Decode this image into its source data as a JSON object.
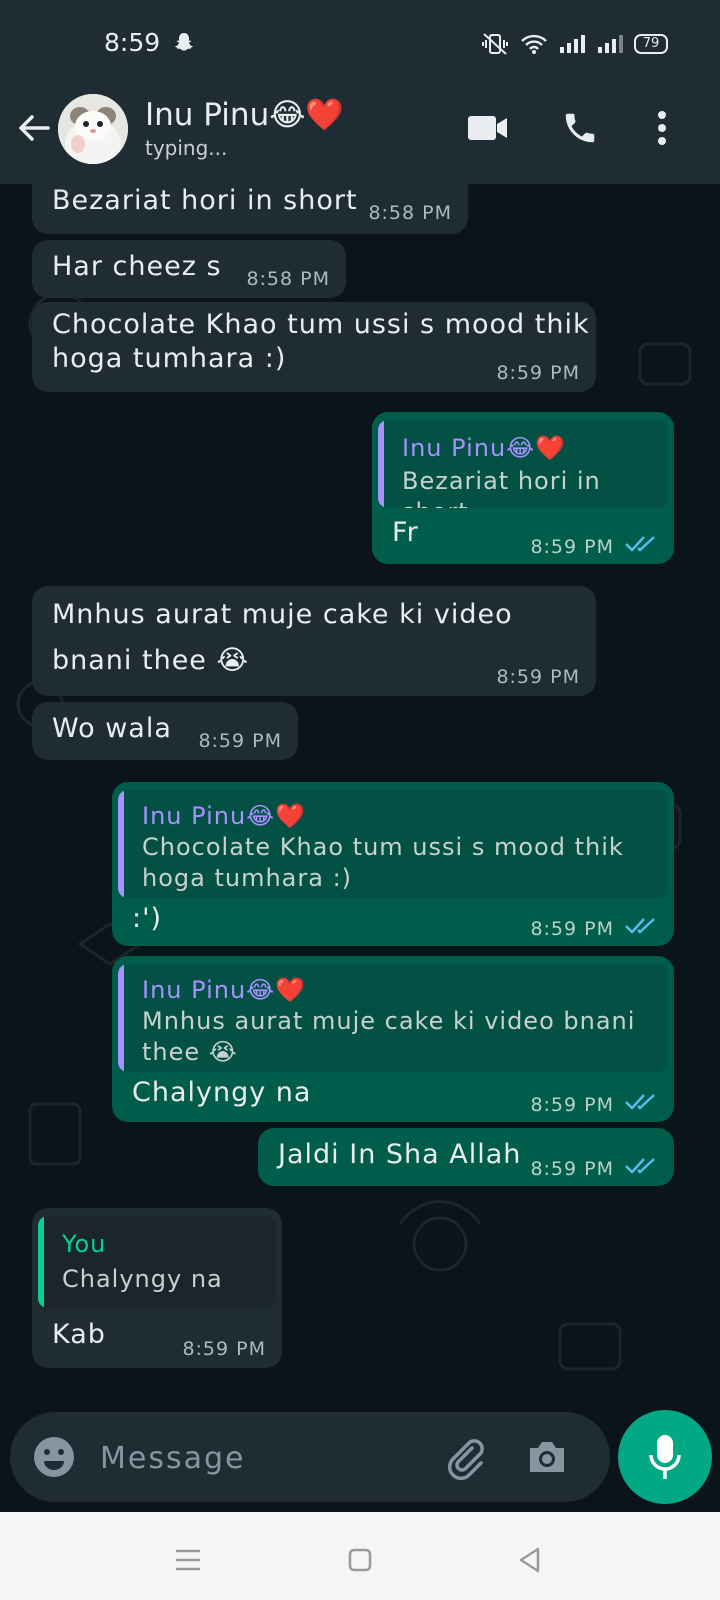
{
  "status_bar": {
    "time": "8:59",
    "battery": "79"
  },
  "contact": {
    "name": "Inu Pinu😂❤️",
    "status": "typing..."
  },
  "messages": [
    {
      "dir": "in",
      "text": "Bezariat hori in short",
      "time": "8:58 PM"
    },
    {
      "dir": "in",
      "text": "Har cheez s",
      "time": "8:58 PM"
    },
    {
      "dir": "in",
      "text": "Chocolate Khao tum ussi s mood thik\nhoga tumhara :)",
      "time": "8:59 PM"
    },
    {
      "dir": "out",
      "quote_name": "Inu Pinu😂❤️",
      "quote_text": "Bezariat hori in short",
      "text": "Fr",
      "time": "8:59 PM"
    },
    {
      "dir": "in",
      "text": "Mnhus aurat muje cake ki video\nbnani thee 😭",
      "time": "8:59 PM"
    },
    {
      "dir": "in",
      "text": "Wo wala",
      "time": "8:59 PM"
    },
    {
      "dir": "out",
      "quote_name": "Inu Pinu😂❤️",
      "quote_text": "Chocolate Khao tum ussi s mood thik\nhoga tumhara :)",
      "text": ":')",
      "time": "8:59 PM"
    },
    {
      "dir": "out",
      "quote_name": "Inu Pinu😂❤️",
      "quote_text": "Mnhus aurat muje cake ki video bnani\nthee 😭",
      "text": "Chalyngy na",
      "time": "8:59 PM"
    },
    {
      "dir": "out",
      "text": "Jaldi In Sha Allah",
      "time": "8:59 PM"
    },
    {
      "dir": "in",
      "quote_name": "You",
      "quote_text": "Chalyngy na",
      "text": "Kab",
      "time": "8:59 PM"
    }
  ],
  "input": {
    "placeholder": "Message"
  },
  "colors": {
    "header": "#1f2c34",
    "incoming": "#1f2c34",
    "outgoing": "#005c4b",
    "accent": "#00a884",
    "quote_contact": "#a791ff",
    "quote_you": "#06cf9c",
    "read_ticks": "#53bdeb"
  }
}
